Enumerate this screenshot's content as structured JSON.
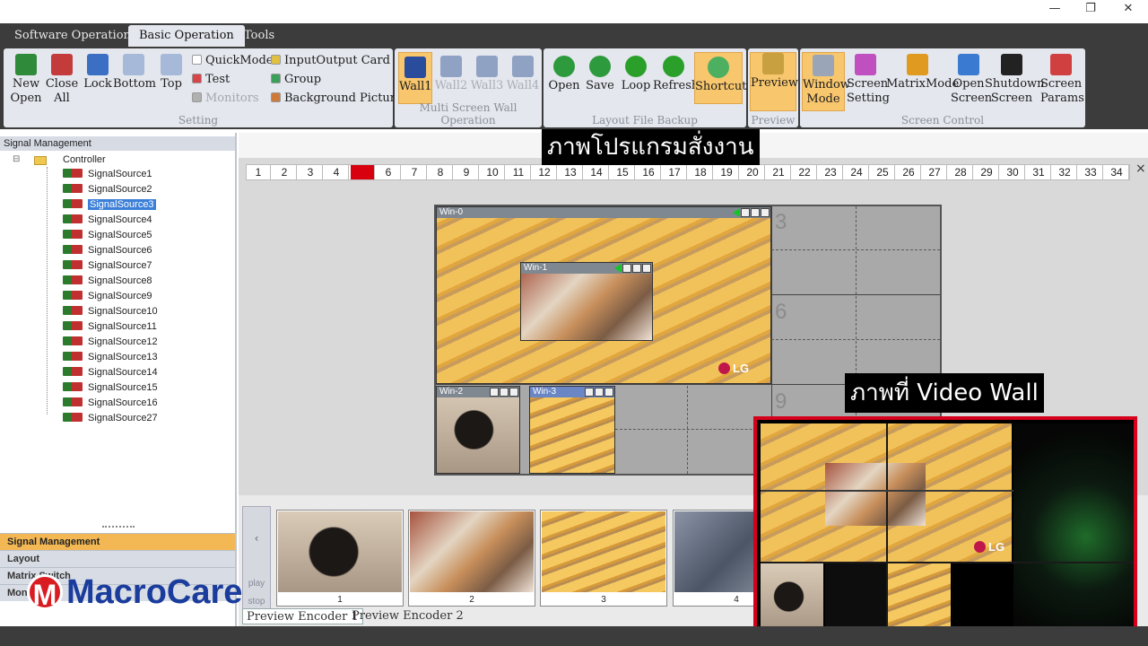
{
  "window_controls": [
    "—",
    "❐",
    "✕"
  ],
  "menu_tabs": [
    "Software Operation",
    "Basic Operation",
    "Tools"
  ],
  "ribbon": {
    "setting": {
      "label": "Setting",
      "buttons": [
        {
          "l1": "New",
          "l2": "Open",
          "color": "#2f8a3a"
        },
        {
          "l1": "Close",
          "l2": "All",
          "color": "#c43b3b"
        },
        {
          "l1": "Lock",
          "l2": "",
          "color": "#3b6fc4"
        },
        {
          "l1": "Bottom",
          "l2": "",
          "color": "#a7b9d8"
        },
        {
          "l1": "Top",
          "l2": "",
          "color": "#a7b9d8"
        }
      ],
      "small": [
        {
          "label": "QuickMode",
          "color": "#ffffff",
          "disabled": false
        },
        {
          "label": "Test",
          "color": "#d6454a",
          "disabled": false
        },
        {
          "label": "Monitors",
          "color": "#b0b0b0",
          "disabled": true
        },
        {
          "label": "InputOutput Card",
          "color": "#e0c040",
          "disabled": false
        },
        {
          "label": "Group",
          "color": "#3ba05a",
          "disabled": false
        },
        {
          "label": "Background Picture",
          "color": "#d07a3a",
          "disabled": false
        }
      ]
    },
    "wall": {
      "label": "Multi Screen Wall Operation",
      "buttons": [
        "Wall1",
        "Wall2",
        "Wall3",
        "Wall4"
      ]
    },
    "layout": {
      "label": "Layout File Backup",
      "buttons": [
        {
          "label": "Open",
          "color": "#2d9a3d"
        },
        {
          "label": "Save",
          "color": "#2d9a3d"
        },
        {
          "label": "Loop",
          "color": "#2aa02a"
        },
        {
          "label": "Refresh",
          "color": "#2aa02a"
        },
        {
          "label": "Shortcut",
          "color": "#4cb060"
        }
      ]
    },
    "preview": {
      "label": "Preview",
      "buttons": [
        "Preview"
      ]
    },
    "screen": {
      "label": "Screen Control",
      "buttons": [
        {
          "l1": "Window",
          "l2": "Mode",
          "color": "#9aa6b8"
        },
        {
          "l1": "Screen",
          "l2": "Setting",
          "color": "#c050c0"
        },
        {
          "l1": "MatrixMode",
          "l2": "",
          "color": "#e09a20"
        },
        {
          "l1": "Open",
          "l2": "Screen",
          "color": "#3a7ad0"
        },
        {
          "l1": "Shutdown",
          "l2": "Screen",
          "color": "#222222"
        },
        {
          "l1": "Screen",
          "l2": "Params",
          "color": "#d04040"
        }
      ]
    }
  },
  "left_panel": {
    "header": "Signal Management",
    "root": "Controller",
    "sources": [
      "SignalSource1",
      "SignalSource2",
      "SignalSource3",
      "SignalSource4",
      "SignalSource5",
      "SignalSource6",
      "SignalSource7",
      "SignalSource8",
      "SignalSource9",
      "SignalSource10",
      "SignalSource11",
      "SignalSource12",
      "SignalSource13",
      "SignalSource14",
      "SignalSource15",
      "SignalSource16",
      "SignalSource27"
    ],
    "selected_index": 2,
    "bottom_tabs": [
      "Signal Management",
      "Layout",
      "Matrix Switch",
      "Mon"
    ]
  },
  "overlay": {
    "top_caption": "ภาพโปรแกรมสั่งงาน",
    "inset_caption": "ภาพที่ Video Wall"
  },
  "page_numbers": [
    "1",
    "2",
    "3",
    "4",
    "5",
    "6",
    "7",
    "8",
    "9",
    "10",
    "11",
    "12",
    "13",
    "14",
    "15",
    "16",
    "17",
    "18",
    "19",
    "20",
    "21",
    "22",
    "23",
    "24",
    "25",
    "26",
    "27",
    "28",
    "29",
    "30",
    "31",
    "32",
    "33",
    "34"
  ],
  "active_page": "5",
  "close_x": "×",
  "wall_cells": [
    "3",
    "6",
    "9"
  ],
  "windows": [
    "Win-0",
    "Win-1",
    "Win-2",
    "Win-3"
  ],
  "lg_text": "LG",
  "thumbnails": [
    "1",
    "2",
    "3",
    "4"
  ],
  "nav": {
    "prev": "‹",
    "play": "play",
    "stop": "stop"
  },
  "preview_tabs": [
    "Preview Encoder 1",
    "Preview Encoder 2"
  ],
  "logo": {
    "m": "M",
    "text": "MacroCare"
  }
}
